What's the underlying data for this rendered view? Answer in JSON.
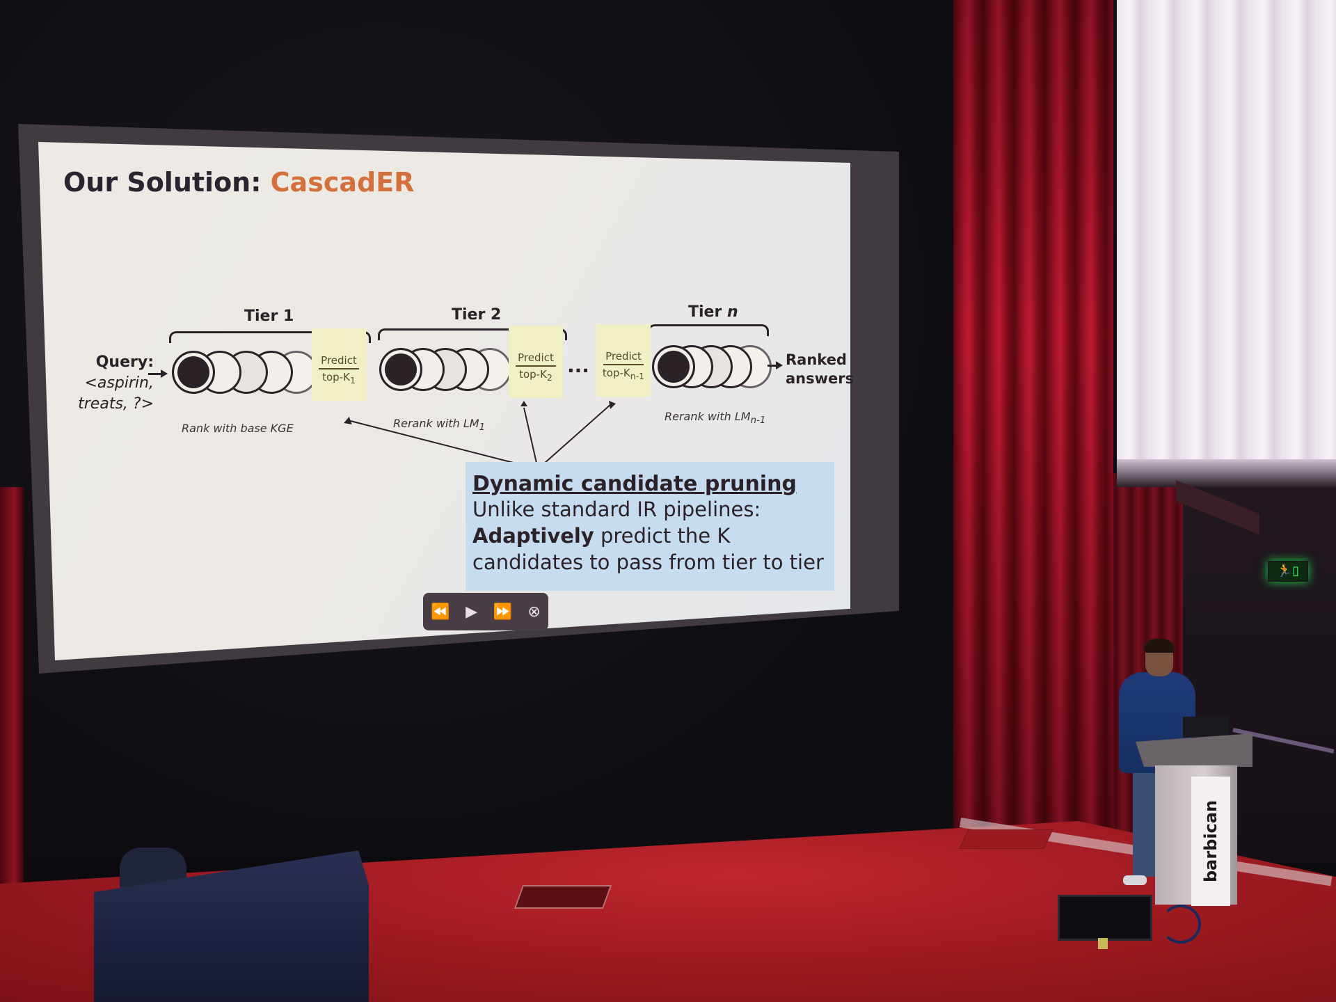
{
  "slide": {
    "title_prefix": "Our Solution:",
    "title_highlight": "CascadER",
    "query_label": "Query:",
    "query_line1": "<aspirin,",
    "query_line2": "treats, ?>",
    "tiers": [
      {
        "label": "Tier 1",
        "caption": "Rank with base KGE"
      },
      {
        "label": "Tier 2",
        "caption": "Rerank with LM",
        "caption_sub": "1"
      },
      {
        "label_prefix": "Tier",
        "label_var": "n",
        "caption": "Rerank with LM",
        "caption_sub": "n-1"
      }
    ],
    "predict_boxes": [
      {
        "line1": "Predict",
        "line2": "top-K",
        "sub": "1"
      },
      {
        "line1": "Predict",
        "line2": "top-K",
        "sub": "2"
      },
      {
        "line1": "Predict",
        "line2": "top-K",
        "sub": "n-1"
      }
    ],
    "ellipsis": "···",
    "ranked_line1": "Ranked",
    "ranked_line2": "answers",
    "callout": {
      "heading": "Dynamic candidate pruning",
      "line1": "Unlike standard IR pipelines:",
      "line2_bold": "Adaptively",
      "line2_rest": " predict the K",
      "line3": "candidates to pass from tier to tier"
    },
    "colors": {
      "highlight": "#d4703c",
      "callout_bg": "#c8dcef",
      "predict_bg": "#f0f0c4"
    }
  },
  "media_controls": {
    "rewind": "⏪",
    "play": "▶",
    "forward": "⏩",
    "close": "⊗"
  },
  "podium_label": "barbican",
  "exit_sign": "🏃▯"
}
